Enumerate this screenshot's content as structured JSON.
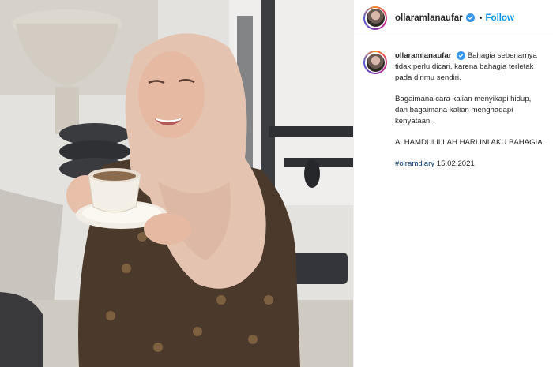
{
  "post": {
    "username": "ollaramlanaufar",
    "follow_label": "Follow",
    "separator": "•"
  },
  "caption": {
    "username": "ollaramlanaufar",
    "paragraph1": "Bahagia sebenarnya tidak perlu dicari, karena bahagia terletak pada dirimu sendiri.",
    "paragraph2": "Bagaimana cara kalian menyikapi hidup, dan bagaimana kalian menghadapi kenyataan.",
    "paragraph3": "ALHAMDULILLAH HARI INI AKU BAHAGIA.",
    "hashtag": "#olramdiary",
    "date": "15.02.2021"
  },
  "colors": {
    "verified_badge": "#3897f0",
    "follow": "#0095f6",
    "hashtag": "#00376b"
  },
  "icons": {
    "verified": "verified-badge-icon",
    "avatar": "profile-avatar"
  }
}
